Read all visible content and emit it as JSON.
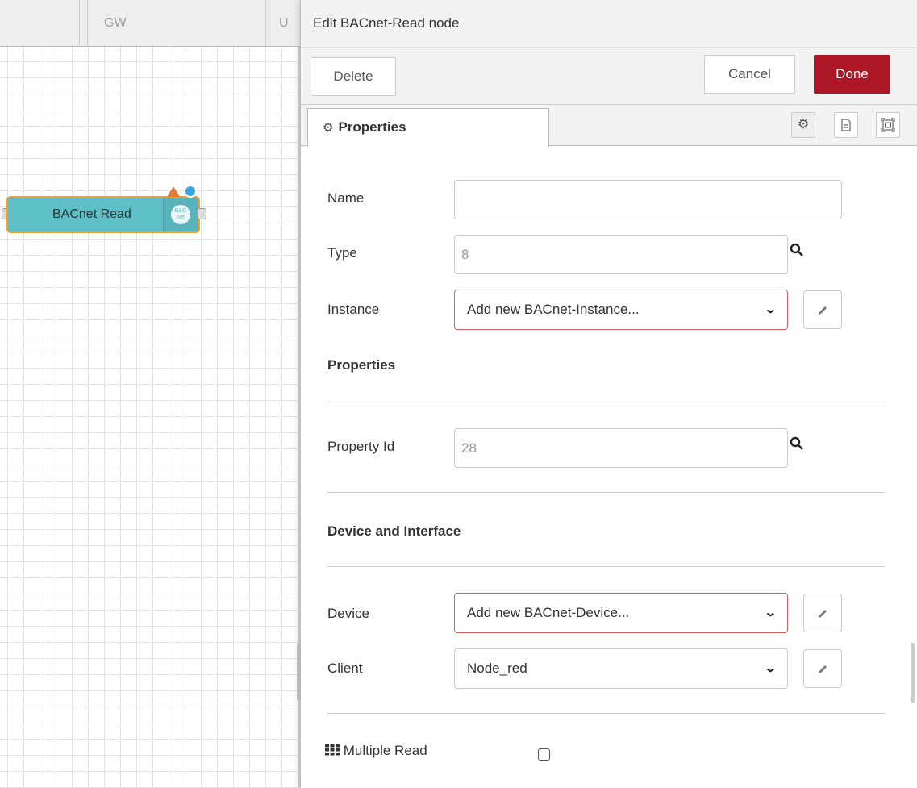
{
  "workspace": {
    "tabs": [
      {
        "label": "GW"
      },
      {
        "label": "U"
      }
    ],
    "node": {
      "label": "BACnet Read",
      "icon_text": "BAC net"
    }
  },
  "tray": {
    "title": "Edit BACnet-Read node",
    "buttons": {
      "delete": "Delete",
      "cancel": "Cancel",
      "done": "Done"
    },
    "tab": {
      "label": "Properties",
      "icon": "gear-icon"
    },
    "fields": {
      "name": {
        "label": "Name",
        "value": ""
      },
      "type": {
        "label": "Type",
        "value": "8"
      },
      "instance": {
        "label": "Instance",
        "selected": "Add new BACnet-Instance..."
      },
      "property_id": {
        "label": "Property Id",
        "value": "28"
      },
      "device": {
        "label": "Device",
        "selected": "Add new BACnet-Device..."
      },
      "client": {
        "label": "Client",
        "selected": "Node_red"
      },
      "multiple_read": {
        "label": "Multiple Read",
        "checked": false
      }
    },
    "sections": {
      "properties": "Properties",
      "device_interface": "Device and Interface"
    }
  },
  "colors": {
    "done_button": "#ad1625",
    "node_fill": "#5ebfc7",
    "node_border": "#f0a030",
    "invalid_border": "#d6615f"
  }
}
